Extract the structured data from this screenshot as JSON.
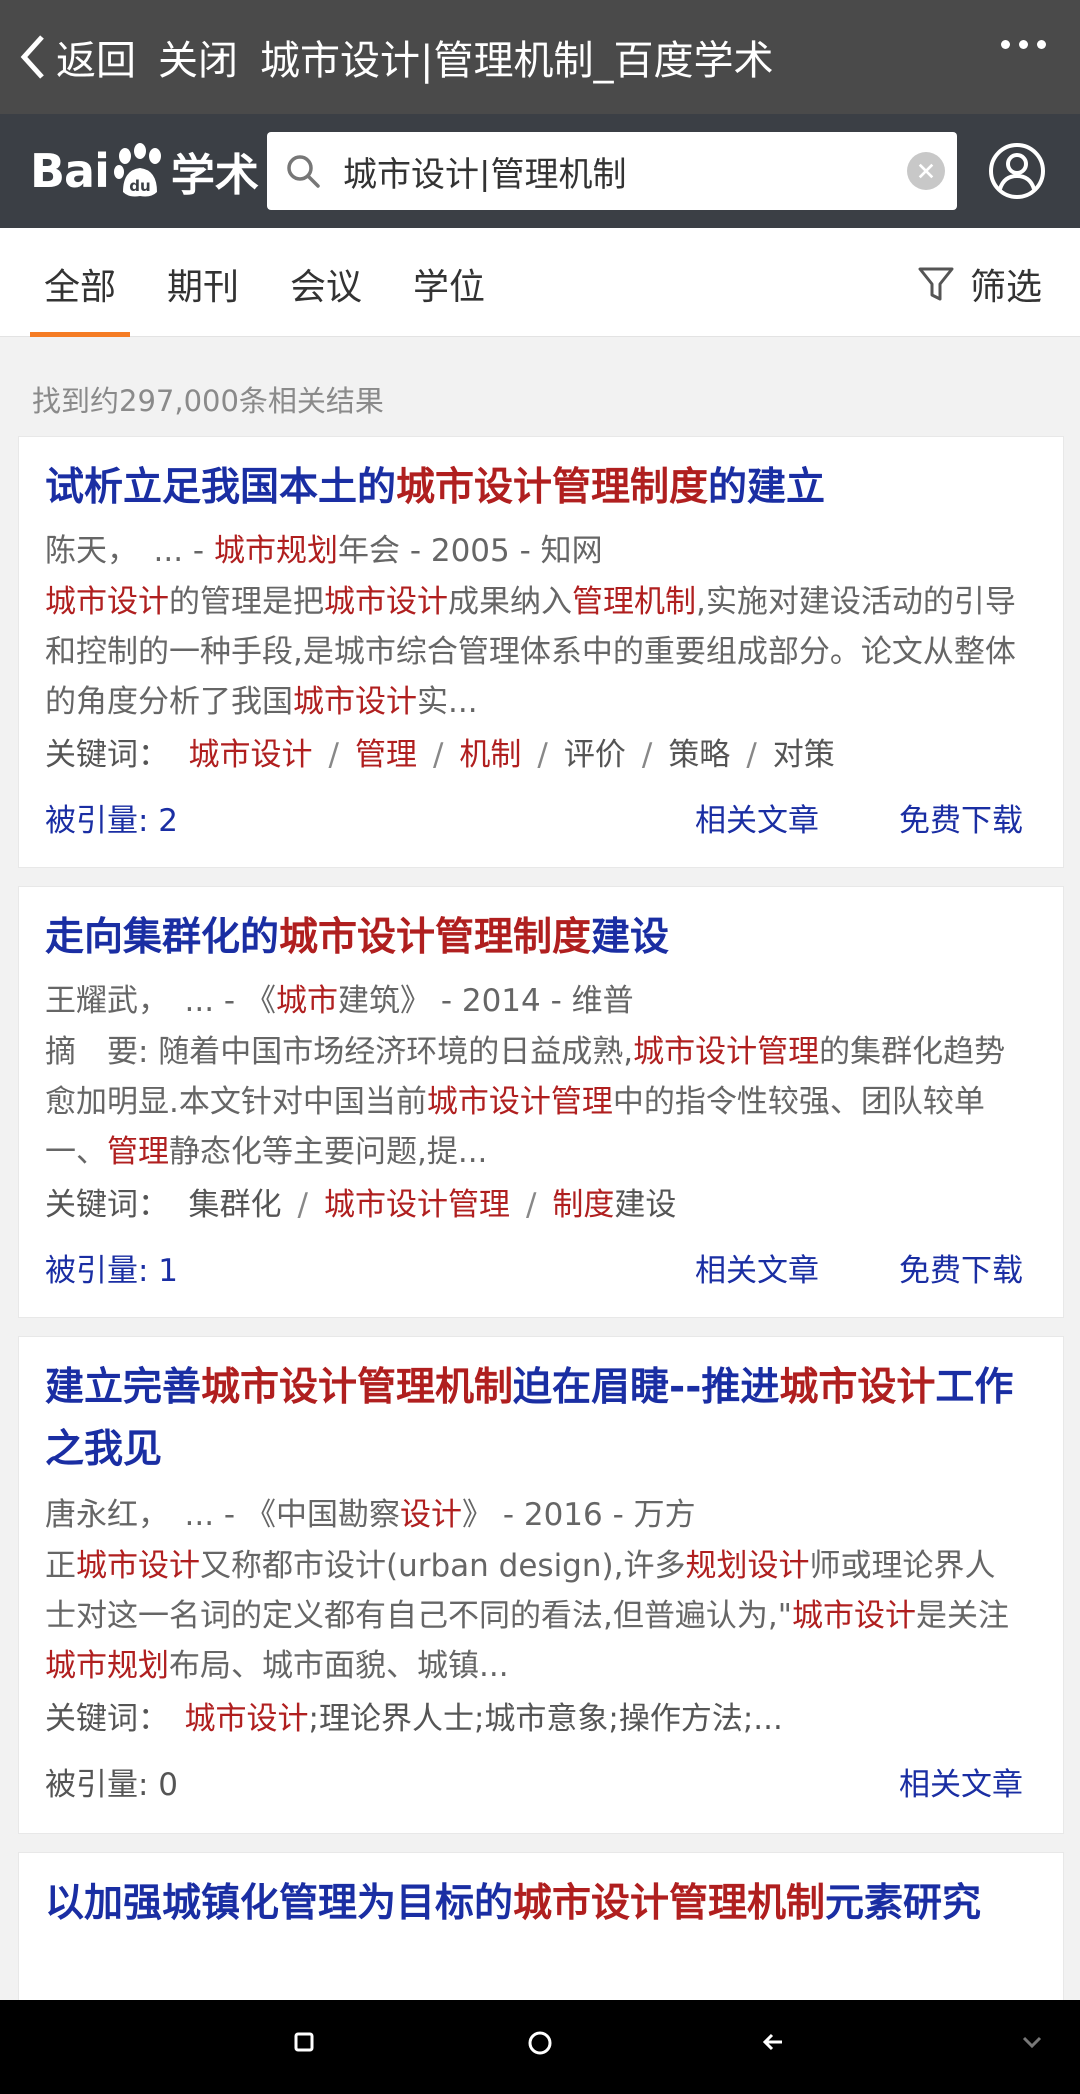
{
  "topbar": {
    "back_label": "返回",
    "close_label": "关闭",
    "title": "城市设计|管理机制_百度学术"
  },
  "search": {
    "logo_bai": "Bai",
    "logo_du": "du",
    "logo_xs": "学术",
    "query": "城市设计|管理机制"
  },
  "tabs": [
    "全部",
    "期刊",
    "会议",
    "学位"
  ],
  "filter_label": "筛选",
  "result_count": "找到约297,000条相关结果",
  "cards": [
    {
      "title": [
        {
          "t": "试析立足我国本土的"
        },
        {
          "t": "城市设计管理制度",
          "hl": true
        },
        {
          "t": "的建立"
        }
      ],
      "meta": [
        {
          "t": "陈天，　... -  "
        },
        {
          "t": "城市规划",
          "hl": true
        },
        {
          "t": "年会  - 2005  -  知网"
        }
      ],
      "abstract": [
        {
          "t": "城市设计",
          "hl": true
        },
        {
          "t": "的管理是把"
        },
        {
          "t": "城市设计",
          "hl": true
        },
        {
          "t": "成果纳入"
        },
        {
          "t": "管理机制",
          "hl": true
        },
        {
          "t": ",实施对建设活动的引导和控制的一种手段,是城市综合管理体系中的重要组成部分。论文从整体的角度分析了我国"
        },
        {
          "t": "城市设计",
          "hl": true
        },
        {
          "t": "实..."
        }
      ],
      "keywords_label": "关键词：",
      "keywords": [
        {
          "t": "城市设计",
          "hl": true
        },
        {
          "t": "管理",
          "hl": true
        },
        {
          "t": "机制",
          "hl": true
        },
        {
          "t": "评价"
        },
        {
          "t": "策略"
        },
        {
          "t": "对策"
        }
      ],
      "cite": "被引量: 2",
      "actions": [
        "相关文章",
        "免费下载"
      ]
    },
    {
      "title": [
        {
          "t": "走向集群化的"
        },
        {
          "t": "城市设计管理制度",
          "hl": true
        },
        {
          "t": "建设"
        }
      ],
      "meta": [
        {
          "t": "王耀武，　... -  《"
        },
        {
          "t": "城市",
          "hl": true
        },
        {
          "t": "建筑》  - 2014  -  维普"
        }
      ],
      "abstract": [
        {
          "t": "摘　要: 随着中国市场经济环境的日益成熟,"
        },
        {
          "t": "城市设计管理",
          "hl": true
        },
        {
          "t": "的集群化趋势愈加明显.本文针对中国当前"
        },
        {
          "t": "城市设计管理",
          "hl": true
        },
        {
          "t": "中的指令性较强、团队较单一、"
        },
        {
          "t": "管理",
          "hl": true
        },
        {
          "t": "静态化等主要问题,提..."
        }
      ],
      "keywords_label": "关键词：",
      "keywords": [
        [
          {
            "t": "集群化"
          }
        ],
        [
          {
            "t": "城市设计管理",
            "hl": true
          }
        ],
        [
          {
            "t": "制度",
            "hl": true
          },
          {
            "t": "建设"
          }
        ]
      ],
      "cite": "被引量: 1",
      "actions": [
        "相关文章",
        "免费下载"
      ]
    },
    {
      "title": [
        {
          "t": "建立完善"
        },
        {
          "t": "城市设计管理机制",
          "hl": true
        },
        {
          "t": "迫在眉睫--推进"
        },
        {
          "t": "城市设计",
          "hl": true
        },
        {
          "t": "工作之我见"
        }
      ],
      "meta": [
        {
          "t": "唐永红，　... -  《中国勘察"
        },
        {
          "t": "设计",
          "hl": true
        },
        {
          "t": "》  - 2016  -  万方"
        }
      ],
      "abstract": [
        {
          "t": "正"
        },
        {
          "t": "城市设计",
          "hl": true
        },
        {
          "t": "又称都市设计(urban design),许多"
        },
        {
          "t": "规划设计",
          "hl": true
        },
        {
          "t": "师或理论界人士对这一名词的定义都有自己不同的看法,但普遍认为,\""
        },
        {
          "t": "城市设计",
          "hl": true
        },
        {
          "t": "是关注"
        },
        {
          "t": "城市规划",
          "hl": true
        },
        {
          "t": "布局、城市面貌、城镇..."
        }
      ],
      "keywords_label": "关键词：",
      "keywords_inline": [
        {
          "t": "城市设计",
          "hl": true
        },
        {
          "t": ";理论界人士;城市意象;操作方法;..."
        }
      ],
      "cite": "被引量: 0",
      "actions": [
        "相关文章"
      ]
    },
    {
      "title": [
        {
          "t": "以加强城镇化管理为目标的"
        },
        {
          "t": "城市设计管理机制",
          "hl": true
        },
        {
          "t": "元素研究"
        }
      ]
    }
  ]
}
